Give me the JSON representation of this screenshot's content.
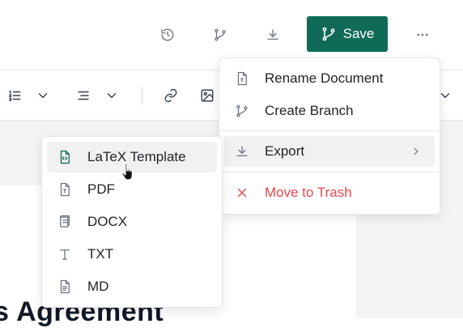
{
  "header": {
    "history_icon": "history-icon",
    "branch_icon": "git-branch-icon",
    "download_icon": "download-icon",
    "save_label": "Save",
    "more_icon": "more-horizontal-icon",
    "accent": "#0f6b57"
  },
  "toolbar": {
    "icons": [
      "list-ordered-icon",
      "chevron-down-icon",
      "align-icon",
      "chevron-down-icon",
      "link-icon",
      "image-icon",
      "chevron-down-icon"
    ]
  },
  "document": {
    "title_fragment": "s Agreement"
  },
  "more_menu": {
    "items": [
      {
        "label": "Rename Document",
        "icon": "file-text-icon"
      },
      {
        "label": "Create Branch",
        "icon": "git-branch-icon"
      },
      {
        "label": "Export",
        "icon": "download-icon"
      },
      {
        "label": "Move to Trash",
        "icon": "x-icon"
      }
    ],
    "danger_color": "#e5484d"
  },
  "export_submenu": {
    "items": [
      {
        "label": "LaTeX Template",
        "icon": "file-code-icon"
      },
      {
        "label": "PDF",
        "icon": "file-text-icon"
      },
      {
        "label": "DOCX",
        "icon": "file-doc-icon"
      },
      {
        "label": "TXT",
        "icon": "type-icon"
      },
      {
        "label": "MD",
        "icon": "file-lines-icon"
      }
    ]
  }
}
